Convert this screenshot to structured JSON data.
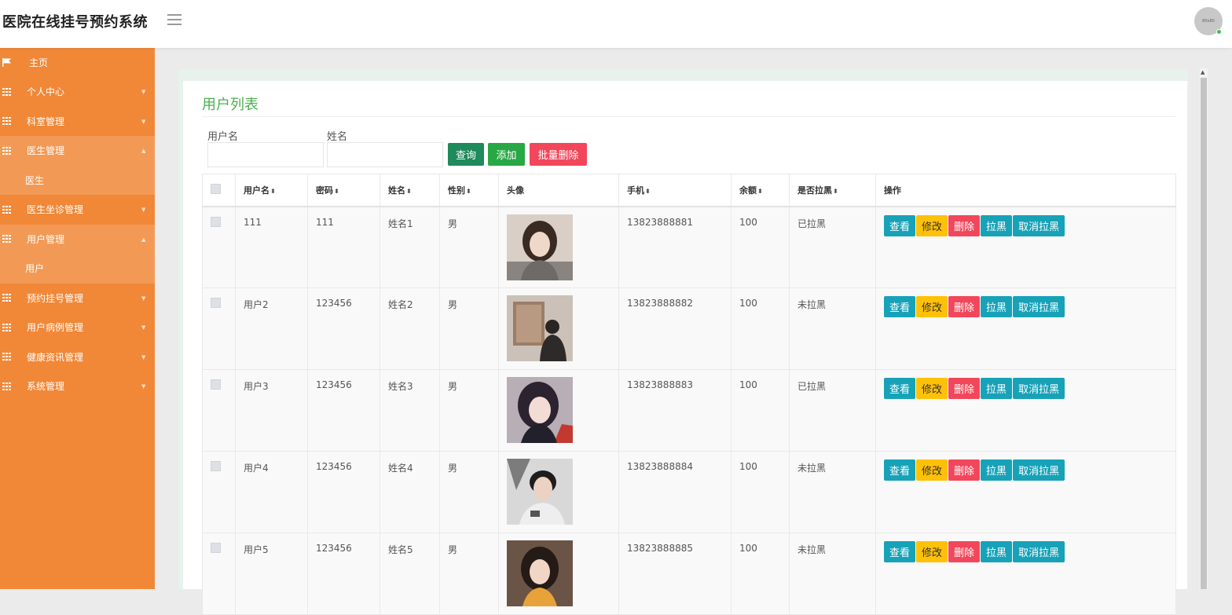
{
  "app_title": "医院在线挂号预约系统",
  "avatar_text": "80x80",
  "sidebar": {
    "home": "主页",
    "items": [
      {
        "label": "个人中心",
        "expanded": false
      },
      {
        "label": "科室管理",
        "expanded": false
      },
      {
        "label": "医生管理",
        "expanded": true,
        "sub": "医生"
      },
      {
        "label": "医生坐诊管理",
        "expanded": false
      },
      {
        "label": "用户管理",
        "expanded": true,
        "sub": "用户"
      },
      {
        "label": "预约挂号管理",
        "expanded": false
      },
      {
        "label": "用户病例管理",
        "expanded": false
      },
      {
        "label": "健康资讯管理",
        "expanded": false
      },
      {
        "label": "系统管理",
        "expanded": false
      }
    ]
  },
  "panel": {
    "title": "用户列表",
    "search": {
      "username_label": "用户名",
      "username_value": "",
      "name_label": "姓名",
      "name_value": ""
    },
    "buttons": {
      "query": "查询",
      "add": "添加",
      "batch_delete": "批量删除"
    }
  },
  "table": {
    "columns": [
      "用户名",
      "密码",
      "姓名",
      "性别",
      "头像",
      "手机",
      "余额",
      "是否拉黑",
      "操作"
    ],
    "sortable": [
      true,
      true,
      true,
      true,
      false,
      true,
      true,
      true,
      false
    ],
    "actions": {
      "view": "查看",
      "edit": "修改",
      "delete": "删除",
      "blacklist": "拉黑",
      "unblacklist": "取消拉黑"
    },
    "rows": [
      {
        "username": "111",
        "password": "111",
        "name": "姓名1",
        "gender": "男",
        "phone": "13823888881",
        "balance": "100",
        "blacklisted": "已拉黑"
      },
      {
        "username": "用户2",
        "password": "123456",
        "name": "姓名2",
        "gender": "男",
        "phone": "13823888882",
        "balance": "100",
        "blacklisted": "未拉黑"
      },
      {
        "username": "用户3",
        "password": "123456",
        "name": "姓名3",
        "gender": "男",
        "phone": "13823888883",
        "balance": "100",
        "blacklisted": "已拉黑"
      },
      {
        "username": "用户4",
        "password": "123456",
        "name": "姓名4",
        "gender": "男",
        "phone": "13823888884",
        "balance": "100",
        "blacklisted": "未拉黑"
      },
      {
        "username": "用户5",
        "password": "123456",
        "name": "姓名5",
        "gender": "男",
        "phone": "13823888885",
        "balance": "100",
        "blacklisted": "未拉黑"
      }
    ]
  },
  "colors": {
    "sidebar": "#f08838",
    "sidebar_active": "#f29a55",
    "title_green": "#4caf50",
    "query_button": "#1f8a5c",
    "add_button": "#28a745",
    "batch_delete_button": "#f2475b",
    "view_button": "#17a2b8",
    "edit_button": "#ffc107",
    "delete_button": "#f2475b"
  }
}
